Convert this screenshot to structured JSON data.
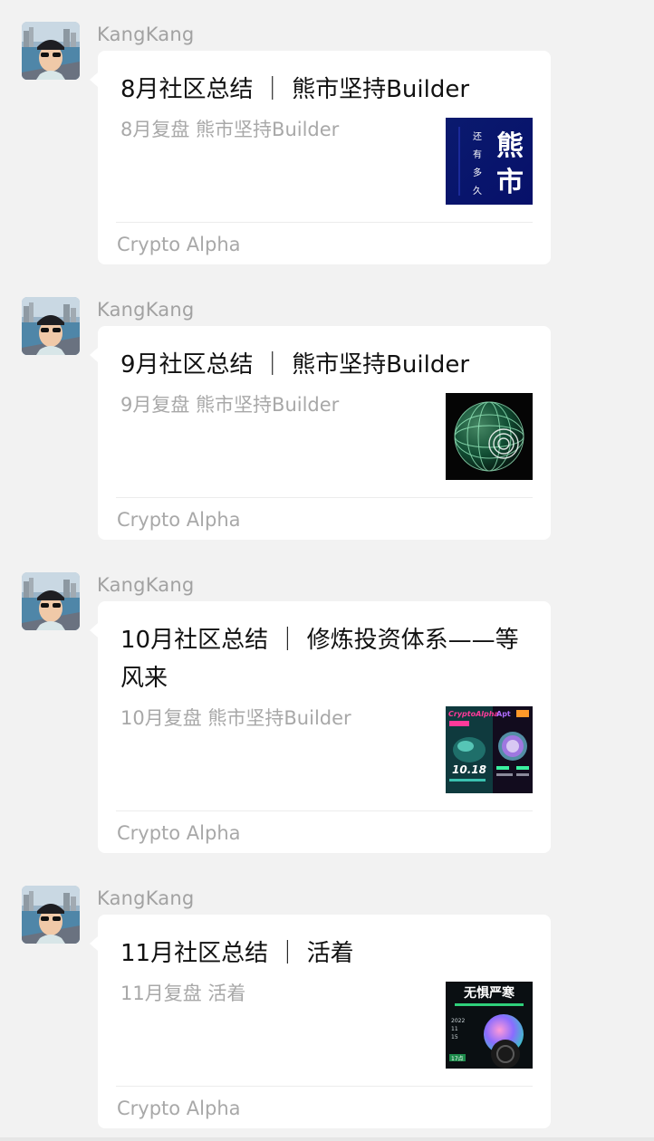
{
  "messages": [
    {
      "sender": "KangKang",
      "title": "8月社区总结 ｜ 熊市坚持Builder",
      "desc": "8月复盘 熊市坚持Builder",
      "source": "Crypto Alpha",
      "thumb_icon": "bear-market-cover-icon",
      "thumb_text": {
        "big1": "熊",
        "big2": "市",
        "small": [
          "还",
          "有",
          "多",
          "久"
        ]
      }
    },
    {
      "sender": "KangKang",
      "title": "9月社区总结 ｜ 熊市坚持Builder",
      "desc": "9月复盘 熊市坚持Builder",
      "source": "Crypto Alpha",
      "thumb_icon": "mesh-sphere-cover-icon"
    },
    {
      "sender": "KangKang",
      "title": "10月社区总结 ｜ 修炼投资体系——等风来",
      "desc": "10月复盘 熊市坚持Builder",
      "source": "Crypto Alpha",
      "thumb_icon": "crypto-alpha-poster-icon",
      "thumb_text": {
        "brand": "CryptoAlpha",
        "date": "10.18",
        "side": "Apt"
      }
    },
    {
      "sender": "KangKang",
      "title": "11月社区总结 ｜ 活着",
      "desc": "11月复盘 活着",
      "source": "Crypto Alpha",
      "thumb_icon": "fearless-winter-poster-icon",
      "thumb_text": {
        "headline": "无惧严寒",
        "year": "2022",
        "m": "11",
        "d": "15",
        "time": "17点"
      }
    }
  ],
  "colors": {
    "background": "#f2f2f2",
    "bubble": "#ffffff",
    "sender": "#a2a2a2",
    "title": "#111111",
    "meta": "#a8a8a8"
  }
}
